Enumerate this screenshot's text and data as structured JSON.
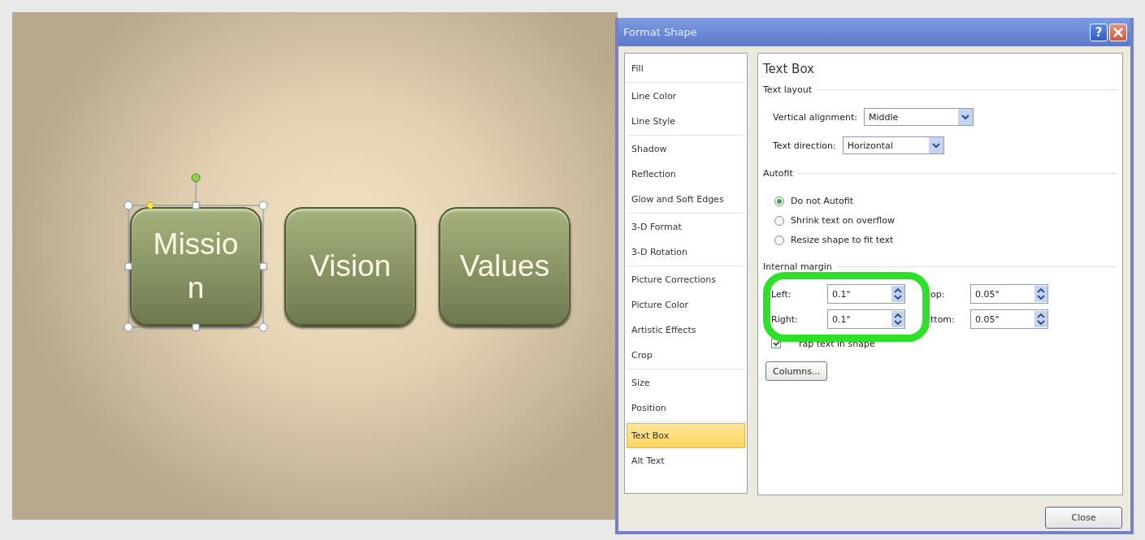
{
  "slide": {
    "shapes": [
      {
        "label": "Mission",
        "selected": true
      },
      {
        "label": "Vision",
        "selected": false
      },
      {
        "label": "Values",
        "selected": false
      }
    ]
  },
  "dialog": {
    "title": "Format Shape",
    "help": "?",
    "sidebar": {
      "groups": [
        {
          "items": [
            {
              "label": "Fill",
              "selected": false
            }
          ]
        },
        {
          "items": [
            {
              "label": "Line Color",
              "selected": false
            },
            {
              "label": "Line Style",
              "selected": false
            }
          ]
        },
        {
          "items": [
            {
              "label": "Shadow",
              "selected": false
            },
            {
              "label": "Reflection",
              "selected": false
            },
            {
              "label": "Glow and Soft Edges",
              "selected": false
            }
          ]
        },
        {
          "items": [
            {
              "label": "3-D Format",
              "selected": false
            },
            {
              "label": "3-D Rotation",
              "selected": false
            }
          ]
        },
        {
          "items": [
            {
              "label": "Picture Corrections",
              "selected": false
            },
            {
              "label": "Picture Color",
              "selected": false
            },
            {
              "label": "Artistic Effects",
              "selected": false
            },
            {
              "label": "Crop",
              "selected": false
            }
          ]
        },
        {
          "items": [
            {
              "label": "Size",
              "selected": false
            },
            {
              "label": "Position",
              "selected": false
            }
          ]
        },
        {
          "items": [
            {
              "label": "Text Box",
              "selected": true
            },
            {
              "label": "Alt Text",
              "selected": false
            }
          ]
        }
      ]
    },
    "panel": {
      "heading": "Text Box",
      "text_layout": {
        "title": "Text layout",
        "fields": [
          {
            "label": "Vertical alignment:",
            "value": "Middle"
          },
          {
            "label": "Text direction:",
            "value": "Horizontal"
          }
        ]
      },
      "autofit": {
        "title": "Autofit",
        "options": [
          {
            "label": "Do not Autofit",
            "selected": true
          },
          {
            "label": "Shrink text on overflow",
            "selected": false
          },
          {
            "label": "Resize shape to fit text",
            "selected": false
          }
        ]
      },
      "internal_margin": {
        "title": "Internal margin",
        "rows": [
          {
            "label": "Left:",
            "value": "0.1\"",
            "label_2": "op:",
            "value_2": "0.05\""
          },
          {
            "label": "Right:",
            "value": "0.1\"",
            "label_2": "ttom:",
            "value_2": "0.05\""
          }
        ],
        "wrap_checked": true,
        "wrap_label": "rap text in shape"
      },
      "columns_button": "Columns..."
    },
    "close_button": "Close"
  }
}
